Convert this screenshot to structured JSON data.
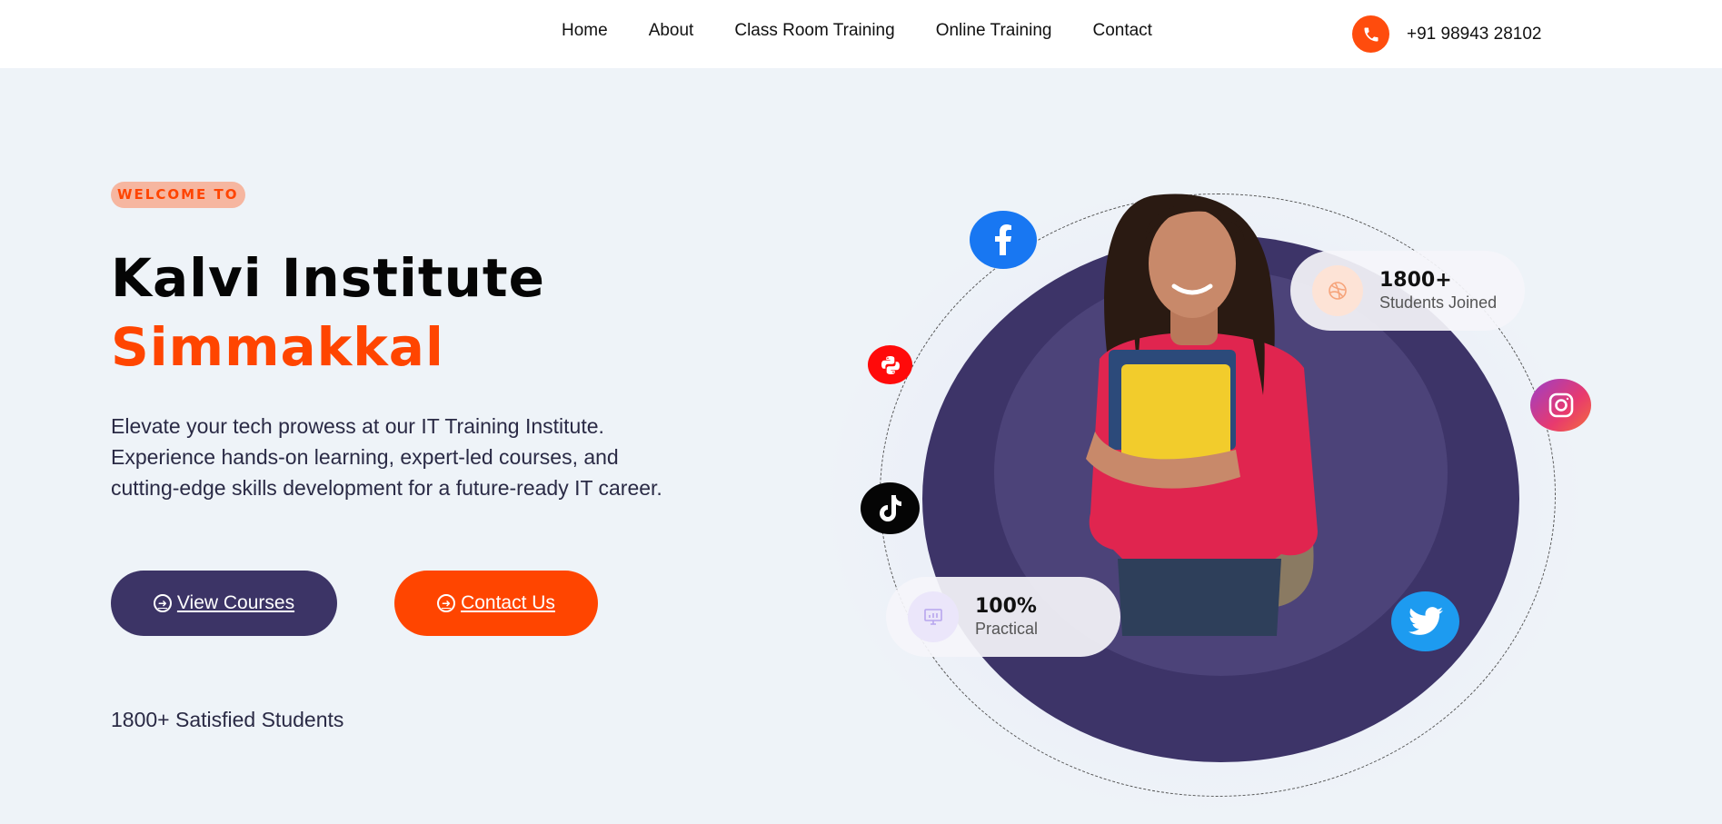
{
  "nav": {
    "items": [
      {
        "label": "Home"
      },
      {
        "label": "About"
      },
      {
        "label": "Class Room Training"
      },
      {
        "label": "Online Training"
      },
      {
        "label": "Contact"
      }
    ],
    "phone": "+91 98943 28102",
    "phone_icon": "phone-icon"
  },
  "hero": {
    "badge": "WELCOME TO",
    "title_line1": "Kalvi Institute",
    "title_line2": "Simmakkal",
    "description": "Elevate your tech prowess at our IT Training Institute. Experience hands-on learning, expert-led courses, and cutting-edge skills development for a future-ready IT career.",
    "buttons": {
      "view_courses": "View Courses",
      "contact_us": "Contact Us"
    },
    "satisfied": "1800+ Satisfied Students"
  },
  "stats": {
    "joined": {
      "number": "1800+",
      "label": "Students Joined",
      "icon": "dribbble-icon"
    },
    "practical": {
      "number": "100%",
      "label": "Practical",
      "icon": "presentation-chart-icon"
    }
  },
  "social": [
    "facebook-icon",
    "python-icon",
    "tiktok-icon",
    "instagram-icon",
    "twitter-icon"
  ],
  "colors": {
    "accent": "#ff4500",
    "primary": "#3c3466",
    "background": "#eef3f8"
  }
}
